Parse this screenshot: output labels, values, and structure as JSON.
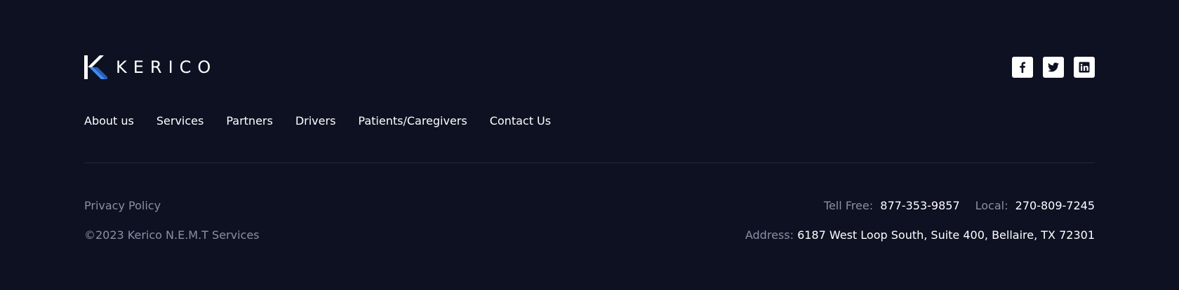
{
  "brand": {
    "name": "KERICO",
    "accent": "#3f8cf0"
  },
  "social": [
    {
      "icon": "facebook-icon"
    },
    {
      "icon": "twitter-icon"
    },
    {
      "icon": "linkedin-icon"
    }
  ],
  "nav": {
    "items": [
      {
        "label": "About us"
      },
      {
        "label": "Services"
      },
      {
        "label": "Partners"
      },
      {
        "label": "Drivers"
      },
      {
        "label": "Patients/Caregivers"
      },
      {
        "label": "Contact Us"
      }
    ]
  },
  "legal": {
    "privacy_label": "Privacy Policy",
    "copyright": "©2023 Kerico N.E.M.T Services"
  },
  "contact": {
    "toll_free_label": "Tell Free:",
    "toll_free_number": "877-353-9857",
    "local_label": "Local:",
    "local_number": "270-809-7245",
    "address_label": "Address:",
    "address_value": "6187 West Loop South, Suite 400, Bellaire, TX 72301"
  },
  "colors": {
    "background": "#0d1122",
    "muted_text": "#8a8fa3",
    "divider": "#232839"
  }
}
